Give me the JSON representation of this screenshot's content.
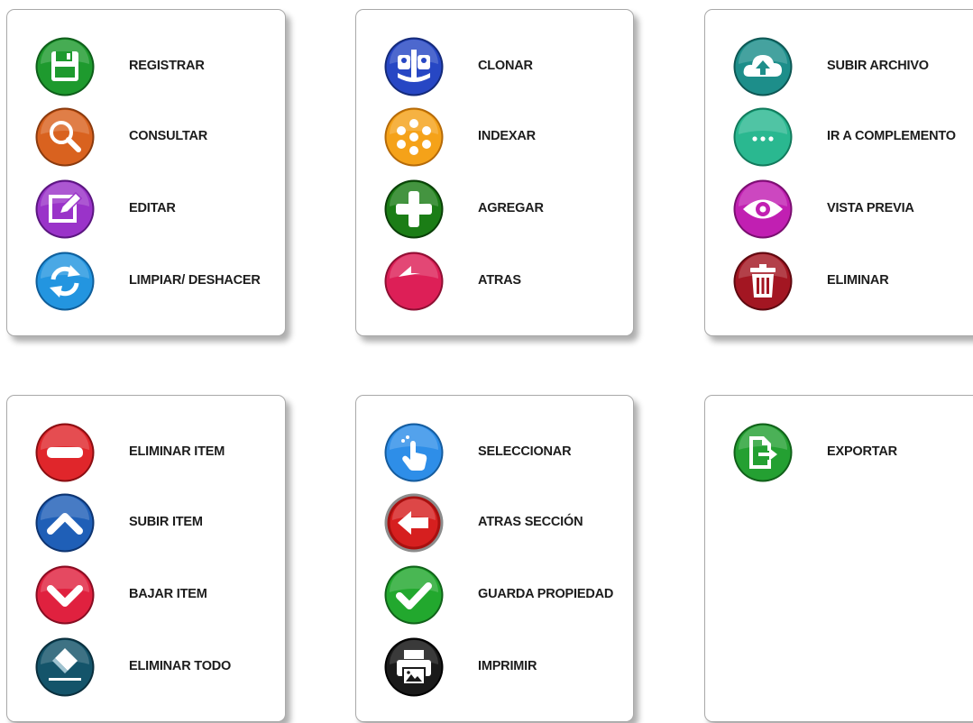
{
  "panels": [
    {
      "items": [
        {
          "label": "REGISTRAR",
          "icon": "floppy-disk-icon",
          "color": "#1e9a2e"
        },
        {
          "label": "CONSULTAR",
          "icon": "magnifier-icon",
          "color": "#d9621f"
        },
        {
          "label": "EDITAR",
          "icon": "edit-pencil-icon",
          "color": "#9a33c9"
        },
        {
          "label": "LIMPIAR/ DESHACER",
          "icon": "refresh-icon",
          "color": "#2395e0"
        }
      ]
    },
    {
      "items": [
        {
          "label": "CLONAR",
          "icon": "clone-icon",
          "color": "#2747c4"
        },
        {
          "label": "INDEXAR",
          "icon": "index-flower-icon",
          "color": "#f5a219"
        },
        {
          "label": "AGREGAR",
          "icon": "plus-icon",
          "color": "#1b7d16"
        },
        {
          "label": "ATRAS",
          "icon": "back-arrow-icon",
          "color": "#dd1f57"
        }
      ]
    },
    {
      "items": [
        {
          "label": "SUBIR ARCHIVO",
          "icon": "cloud-upload-icon",
          "color": "#1d8e8a"
        },
        {
          "label": "IR A COMPLEMENTO",
          "icon": "more-dots-icon",
          "color": "#2ab890"
        },
        {
          "label": "VISTA PREVIA",
          "icon": "eye-icon",
          "color": "#c11fb2"
        },
        {
          "label": "ELIMINAR",
          "icon": "trash-icon",
          "color": "#a31622"
        }
      ]
    },
    {
      "items": [
        {
          "label": "ELIMINAR ITEM",
          "icon": "minus-icon",
          "color": "#e0262b"
        },
        {
          "label": "SUBIR ITEM",
          "icon": "chevron-up-icon",
          "color": "#1f5fb7"
        },
        {
          "label": "BAJAR ITEM",
          "icon": "chevron-down-icon",
          "color": "#e0213f"
        },
        {
          "label": "ELIMINAR TODO",
          "icon": "eraser-icon",
          "color": "#14546a"
        }
      ]
    },
    {
      "items": [
        {
          "label": "SELECCIONAR",
          "icon": "hand-pointer-icon",
          "color": "#2e8ee8"
        },
        {
          "label": "ATRAS SECCIÓN",
          "icon": "arrow-left-icon",
          "color": "#d61f1f"
        },
        {
          "label": "GUARDA PROPIEDAD",
          "icon": "checkmark-icon",
          "color": "#22a82e"
        },
        {
          "label": "IMPRIMIR",
          "icon": "printer-icon",
          "color": "#1a1a1a"
        }
      ]
    },
    {
      "items": [
        {
          "label": "EXPORTAR",
          "icon": "export-file-icon",
          "color": "#24a032"
        }
      ]
    }
  ]
}
